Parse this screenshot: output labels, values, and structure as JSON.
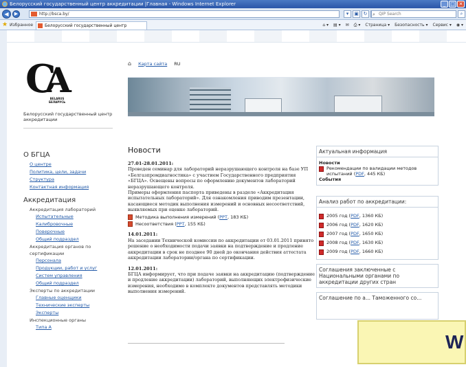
{
  "window": {
    "title": "Белорусский государственный центр аккредитации |Главная - Windows Internet Explorer",
    "buttons": [
      "_",
      "□",
      "✕"
    ]
  },
  "address": {
    "url": "http://bsca.by/",
    "search_placeholder": "QIP Search"
  },
  "favorites": {
    "label": "Избранное",
    "tab_title": "Белорусский государственный центр аккредитац...",
    "cmd": [
      "Страница ▾",
      "Безопасность ▾",
      "Сервис ▾",
      "◉ ▾"
    ]
  },
  "logo": {
    "badge_line1": "BELARUS",
    "badge_line2": "БЕЛАРУСЬ",
    "org_name": "Белорусский государственный центр аккредитации"
  },
  "topnav": {
    "sitemap": "Карта сайта",
    "lang": "RU"
  },
  "left_nav": {
    "section1": "О БГЦА",
    "about": [
      "О центре",
      "Политика, цели, задачи",
      "Структура",
      "Контактная информация"
    ],
    "section2": "Аккредитация",
    "labs_heading": "Аккредитация лабораторий",
    "labs": [
      "Испытательные",
      "Калибровочные",
      "Поверочные",
      "Общий подраздел"
    ],
    "orgs_heading": "Аккредитация органов по сертификации",
    "orgs": [
      "Персонала",
      "Продукции, работ и услуг",
      "Систем управления",
      "Общий подраздел"
    ],
    "experts_heading": "Эксперты по аккредитации",
    "experts": [
      "Главные оценщики",
      "Технические эксперты",
      "Эксперты"
    ],
    "inspect_heading": "Инспекционные органы",
    "inspect": [
      "Типа А"
    ]
  },
  "news": {
    "title": "Новости",
    "items": [
      {
        "date": "27.01-28.01.2011:",
        "text1": "Проведен семинар для лабораторий неразрушающего контроля на базе УП «Белгазпромдиагностика» с участием Государственного предприятия «БГЦА». Освещены вопросы по оформлению документов лабораторий неразрушающего контроля.",
        "text2": "Примеры оформления паспорта приведены в разделе «Аккредитация испытательных лабораторий». Для ознакомления приводим презентации, касающиеся методик выполнения измерений и основных несоответствий, выявляемых при оценке лабораторий.",
        "att1_label": "Методика выполнения измерений (",
        "att1_link": "PPT",
        "att1_size": ", 183 КБ)",
        "att2_label": "Несоответствия (",
        "att2_link": "PPT",
        "att2_size": ", 155 КБ)"
      },
      {
        "date": "14.01.2011:",
        "text": "На заседании Технической комиссии по аккредитации от 03.01.2011 принято решение о необходимости подачи заявки на подтверждение и продление аккредитации в срок не позднее 90 дней до окончания действия аттестата аккредитации лаборатории/органа по сертификации."
      },
      {
        "date": "12.01.2011:",
        "text": "БГЦА информирует, что при подаче заявки на аккредитацию (подтверждение и продление аккредитации) лабораторий, выполняющих электрофизические измерения, необходимо в комплекте документов представлять методики выполнения измерений."
      }
    ]
  },
  "right": {
    "box1_title": "Актуальная информация",
    "news_label": "Новости",
    "news_item": "Рекомендации по валидации методов испытаний (",
    "news_link": "PDF",
    "news_size": ", 445 КБ)",
    "events_label": "События",
    "box2_title": "Анализ работ по аккредитации:",
    "reports": [
      {
        "year": "2005 год (",
        "link": "PDF",
        "size": ", 1360 КБ)"
      },
      {
        "year": "2006 год (",
        "link": "PDF",
        "size": ", 1620 КБ)"
      },
      {
        "year": "2007 год (",
        "link": "PDF",
        "size": ", 1650 КБ)"
      },
      {
        "year": "2008 год (",
        "link": "PDF",
        "size": ", 1630 КБ)"
      },
      {
        "year": "2009 год (",
        "link": "PDF",
        "size": ", 1660 КБ)"
      }
    ],
    "box3_text": "Соглашения заключенные с Национальными органами по аккредитации других стран",
    "box4_text": "Соглашение по а... Таможенного со..."
  },
  "overlay": {
    "text": "W"
  }
}
